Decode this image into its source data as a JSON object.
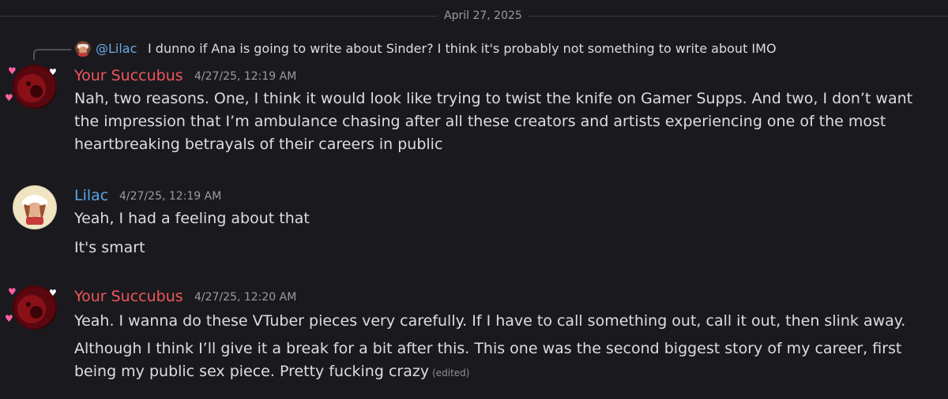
{
  "date_divider": "April 27, 2025",
  "reply": {
    "mention": "@Lilac",
    "text": "I dunno if Ana is going to write about Sinder? I think it's probably not something to write about IMO"
  },
  "messages": [
    {
      "author": "Your Succubus",
      "author_color": "#f0565b",
      "timestamp": "4/27/25, 12:19 AM",
      "lines": [
        "Nah, two reasons. One, I think it would look like trying to twist the knife on Gamer Supps. And two, I don’t want the impression that I’m ambulance chasing after all these creators and artists experiencing one of the most heartbreaking betrayals of their careers in public"
      ]
    },
    {
      "author": "Lilac",
      "author_color": "#5aa5e8",
      "timestamp": "4/27/25, 12:19 AM",
      "lines": [
        "Yeah, I had a feeling about that",
        "It's smart"
      ]
    },
    {
      "author": "Your Succubus",
      "author_color": "#f0565b",
      "timestamp": "4/27/25, 12:20 AM",
      "lines": [
        "Yeah. I wanna do these VTuber pieces very carefully. If I have to call something out, call it out, then slink away.",
        "Although I think I’ll give it a break for a bit after this. This one was the second biggest story of my career, first being my public sex piece. Pretty fucking crazy"
      ],
      "edited_label": "(edited)"
    }
  ]
}
